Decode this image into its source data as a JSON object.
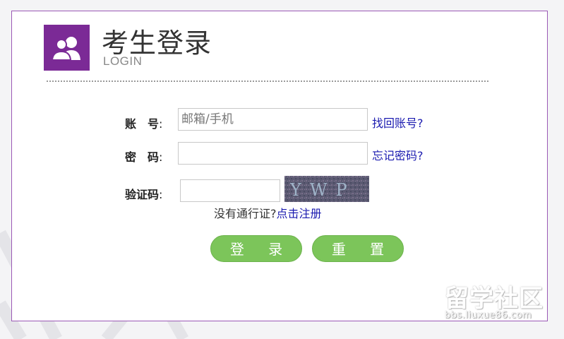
{
  "header": {
    "title": "考生登录",
    "subtitle": "LOGIN",
    "logo_icon": "users-icon"
  },
  "form": {
    "account": {
      "label": "账　号",
      "colon": ":",
      "placeholder": "邮箱/手机",
      "value": "",
      "link": "找回账号?"
    },
    "password": {
      "label": "密　码",
      "colon": ":",
      "value": "",
      "link": "忘记密码?"
    },
    "captcha": {
      "label": "验证码",
      "colon": ":",
      "value": "",
      "image_text": "YWP"
    }
  },
  "register": {
    "prompt": "没有通行证?",
    "link": "点击注册"
  },
  "buttons": {
    "login": "登 录",
    "reset": "重 置"
  },
  "watermark": {
    "main": "留学社区",
    "sub": "bbs.liuxue86.com"
  },
  "colors": {
    "accent_purple": "#7b2a96",
    "panel_border": "#9b59b6",
    "button_green": "#7cc55a",
    "link_blue": "#1b1bb0"
  }
}
